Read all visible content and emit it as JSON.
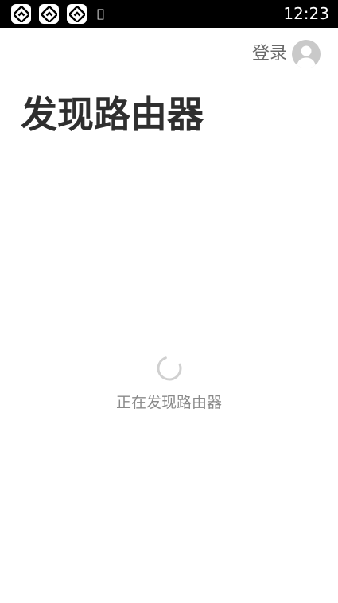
{
  "status_bar": {
    "time": "12:23",
    "notification_icons": [
      "app-notification-icon",
      "app-notification-icon",
      "app-notification-icon"
    ],
    "extra_glyph": "𠅀"
  },
  "header": {
    "login_label": "登录",
    "avatar_icon": "user-avatar-icon"
  },
  "page": {
    "title": "发现路由器"
  },
  "loading": {
    "spinner_icon": "loading-spinner-icon",
    "text": "正在发现路由器"
  },
  "colors": {
    "status_bar_bg": "#000000",
    "title": "#2f2f2f",
    "muted_text": "#8a8a8a",
    "login_text": "#6a6a6a",
    "avatar_bg": "#c9c9c9",
    "spinner": "#d0d0d0"
  }
}
